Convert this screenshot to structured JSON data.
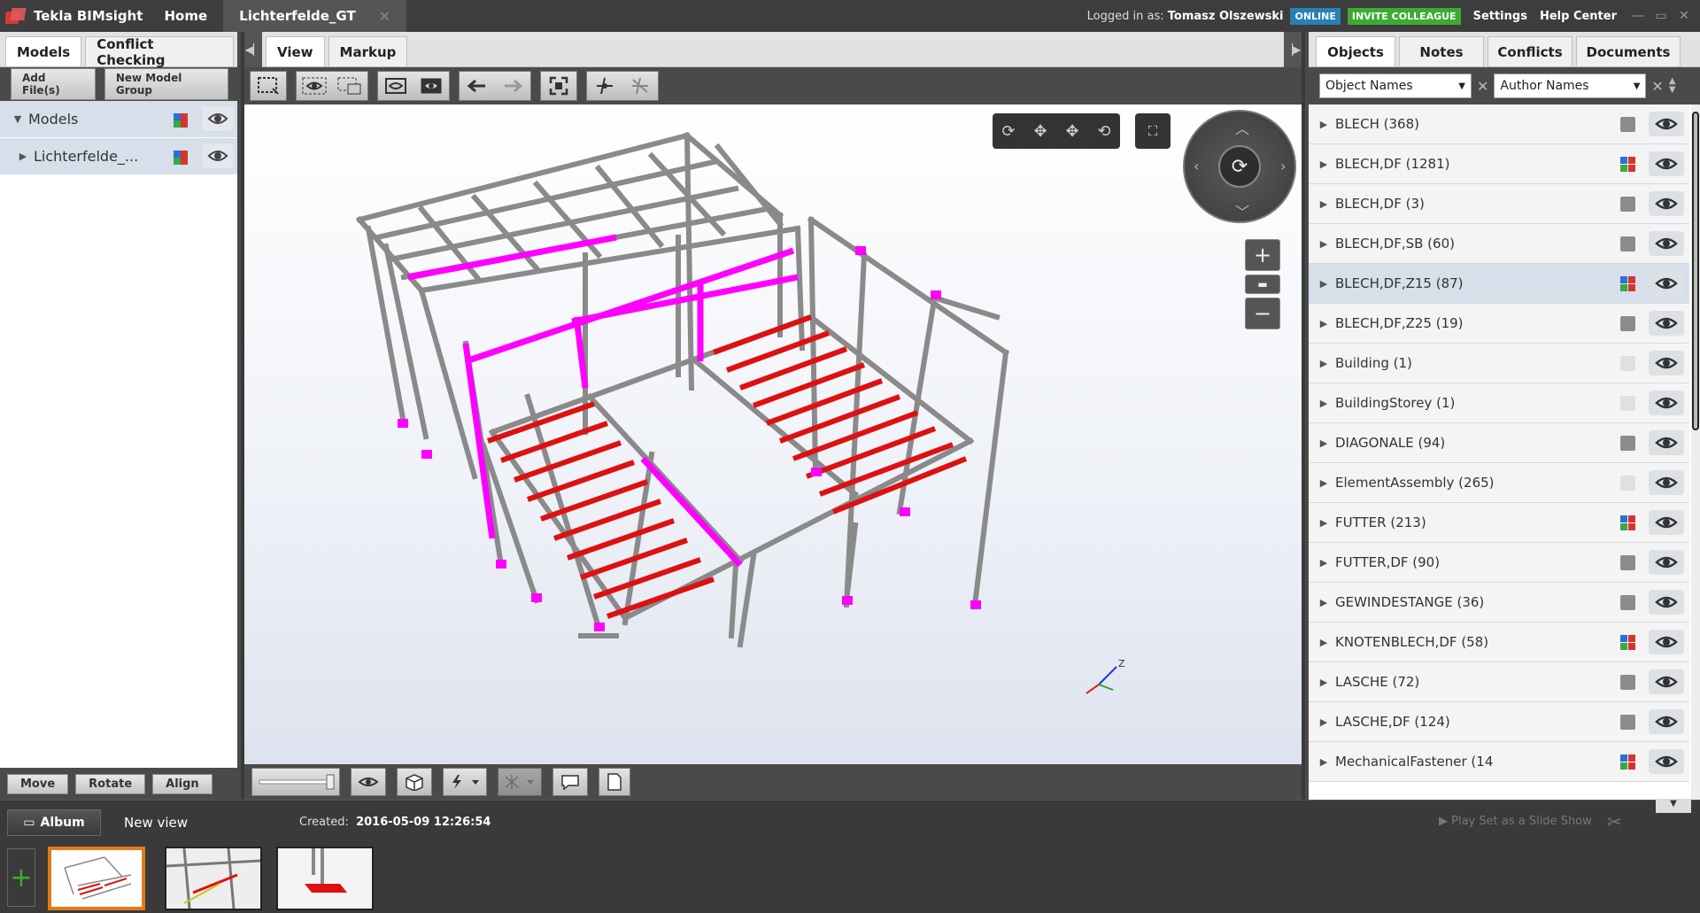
{
  "titlebar": {
    "app_name": "Tekla BIMsight",
    "home": "Home",
    "project_tab": "Lichterfelde_GT",
    "logged_in_label": "Logged in as:",
    "user": "Tomasz Olszewski",
    "online": "ONLINE",
    "invite": "INVITE COLLEAGUE",
    "settings": "Settings",
    "help": "Help Center"
  },
  "left": {
    "tabs": [
      "Models",
      "Conflict Checking"
    ],
    "add_files": "Add File(s)",
    "new_group": "New Model Group",
    "tree": [
      {
        "label": "Models",
        "expanded": true
      },
      {
        "label": "Lichterfelde_...",
        "expanded": false
      }
    ],
    "bottom": [
      "Move",
      "Rotate",
      "Align"
    ]
  },
  "center": {
    "tabs": [
      "View",
      "Markup"
    ]
  },
  "right": {
    "tabs": [
      "Objects",
      "Notes",
      "Conflicts",
      "Documents"
    ],
    "filter1": "Object Names",
    "filter2": "Author Names",
    "items": [
      {
        "label": "BLECH (368)",
        "swatch": "gray"
      },
      {
        "label": "BLECH,DF (1281)",
        "swatch": "multi"
      },
      {
        "label": "BLECH,DF  (3)",
        "swatch": "gray"
      },
      {
        "label": "BLECH,DF,SB (60)",
        "swatch": "gray"
      },
      {
        "label": "BLECH,DF,Z15 (87)",
        "swatch": "multi",
        "selected": true
      },
      {
        "label": "BLECH,DF,Z25 (19)",
        "swatch": "gray"
      },
      {
        "label": "Building (1)",
        "swatch": "light"
      },
      {
        "label": "BuildingStorey (1)",
        "swatch": "light"
      },
      {
        "label": "DIAGONALE (94)",
        "swatch": "gray"
      },
      {
        "label": "ElementAssembly (265)",
        "swatch": "light"
      },
      {
        "label": "FUTTER (213)",
        "swatch": "multi"
      },
      {
        "label": "FUTTER,DF (90)",
        "swatch": "gray"
      },
      {
        "label": "GEWINDESTANGE (36)",
        "swatch": "gray"
      },
      {
        "label": "KNOTENBLECH,DF (58)",
        "swatch": "multi"
      },
      {
        "label": "LASCHE (72)",
        "swatch": "gray"
      },
      {
        "label": "LASCHE,DF (124)",
        "swatch": "gray"
      },
      {
        "label": "MechanicalFastener (14",
        "swatch": "multi"
      }
    ]
  },
  "album": {
    "button": "Album",
    "view_name": "New view",
    "created_label": "Created:",
    "created_value": "2016-05-09 12:26:54",
    "slideshow": "Play Set as a Slide Show"
  },
  "colors": {
    "highlight_magenta": "#ff00ff",
    "highlight_red": "#dd1111",
    "steel_gray": "#8a8a8a",
    "accent_orange": "#e07b1a"
  }
}
